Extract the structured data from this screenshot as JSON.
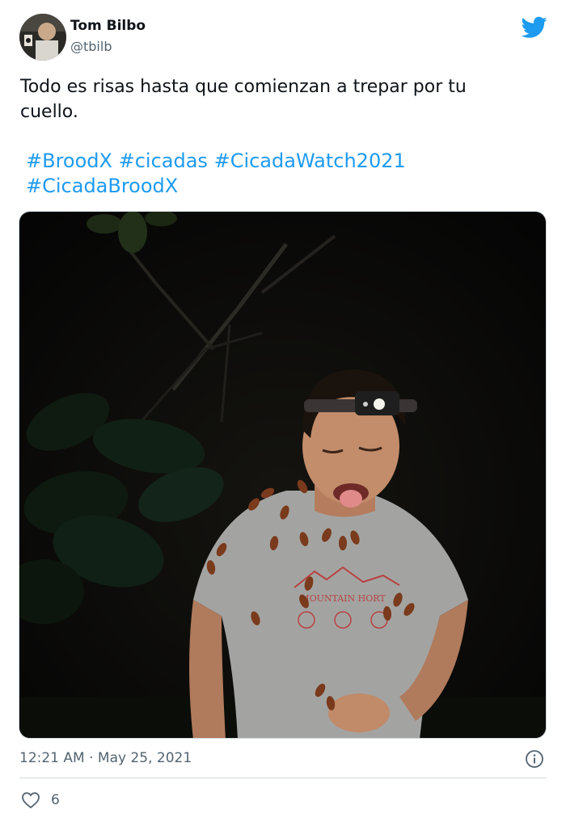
{
  "author": {
    "name": "Tom Bilbo",
    "handle": "@tbilb"
  },
  "icons": {
    "brand": "twitter-bird-icon",
    "info": "info-icon",
    "like": "heart-icon"
  },
  "colors": {
    "link": "#1d9bf0",
    "secondary_text": "#536471",
    "divider": "#cfd9de"
  },
  "tweet": {
    "text_line1": "Todo es risas hasta que comienzan a trepar por tu",
    "text_line2": "cuello.",
    "hashtags": [
      "#BroodX",
      "#cicadas",
      "#CicadaWatch2021",
      "#CicadaBroodX"
    ]
  },
  "media": {
    "shirt_print": "MOUNTAIN HORT"
  },
  "footer": {
    "time": "12:21 AM",
    "separator": "·",
    "date": "May 25, 2021",
    "likes": "6"
  }
}
